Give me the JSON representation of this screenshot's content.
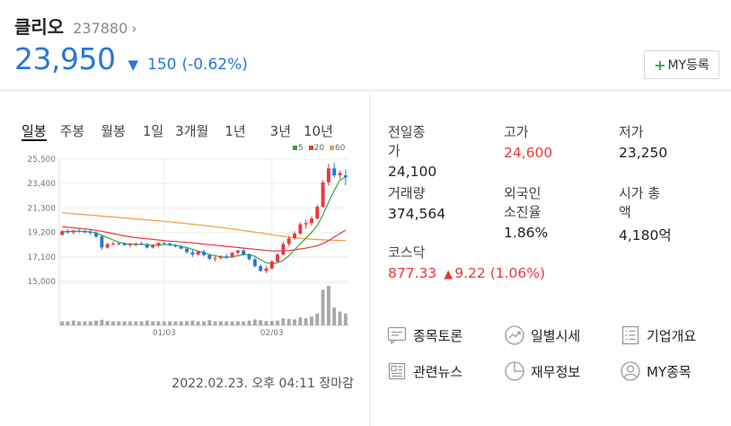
{
  "stock": {
    "name": "클리오",
    "code": "237880",
    "price": "23,950",
    "change": "150",
    "change_pct": "(-0.62%)",
    "direction": "down",
    "my_button": "MY등록"
  },
  "period_tabs": [
    "일봉",
    "주봉",
    "월봉",
    "1일",
    "3개월",
    "1년",
    "3년",
    "10년"
  ],
  "active_tab": "일봉",
  "legend": [
    "5",
    "20",
    "60"
  ],
  "stats": {
    "prev_close_label": "전일종가",
    "prev_close": "24,100",
    "high_label": "고가",
    "high": "24,600",
    "low_label": "저가",
    "low": "23,250",
    "volume_label": "거래량",
    "volume": "374,564",
    "foreign_label": "외국인소진율",
    "foreign": "1.86%",
    "market_cap_label": "시가 총액",
    "market_cap": "4,180억",
    "index_label": "코스닥",
    "index_value": "877.33",
    "index_change": "9.22",
    "index_change_pct": "(1.06%)"
  },
  "links": [
    "종목토론",
    "일별시세",
    "기업개요",
    "관련뉴스",
    "재무정보",
    "MY종목"
  ],
  "timestamp": "2022.02.23. 오후 04:11 장마감",
  "colors": {
    "down": "#2677d9",
    "up": "#e9383f",
    "ma5": "#2fa83a",
    "ma20": "#e9383f",
    "ma60": "#f29a4a"
  },
  "chart_data": {
    "type": "candlestick",
    "y_ticks": [
      "25,500",
      "23,400",
      "21,300",
      "19,200",
      "17,100",
      "15,000"
    ],
    "ylim": [
      15000,
      25500
    ],
    "x_ticks": [
      "01/03",
      "02/03"
    ],
    "x_tick_index": [
      18,
      37
    ],
    "candles": [
      [
        19000,
        19400,
        18900,
        19300
      ],
      [
        19300,
        19500,
        19100,
        19200
      ],
      [
        19200,
        19400,
        19000,
        19350
      ],
      [
        19350,
        19500,
        19150,
        19300
      ],
      [
        19300,
        19450,
        19100,
        19250
      ],
      [
        19250,
        19400,
        19000,
        19150
      ],
      [
        19150,
        19300,
        18700,
        18850
      ],
      [
        18850,
        19000,
        17700,
        17900
      ],
      [
        17900,
        18300,
        17800,
        18200
      ],
      [
        18200,
        18400,
        18050,
        18250
      ],
      [
        18250,
        18400,
        18100,
        18200
      ],
      [
        18200,
        18350,
        18050,
        18100
      ],
      [
        18100,
        18300,
        17900,
        18200
      ],
      [
        18200,
        18350,
        18000,
        18250
      ],
      [
        18250,
        18400,
        18100,
        18150
      ],
      [
        18150,
        18300,
        17800,
        17900
      ],
      [
        17900,
        18200,
        17800,
        18100
      ],
      [
        18100,
        18350,
        17950,
        18300
      ],
      [
        18300,
        18450,
        18200,
        18250
      ],
      [
        18250,
        18350,
        18000,
        18100
      ],
      [
        18100,
        18200,
        17900,
        18000
      ],
      [
        18000,
        18100,
        17750,
        17800
      ],
      [
        17800,
        17950,
        17400,
        17500
      ],
      [
        17500,
        17700,
        17100,
        17300
      ],
      [
        17300,
        17600,
        17200,
        17550
      ],
      [
        17550,
        17700,
        17150,
        17250
      ],
      [
        17250,
        17350,
        16800,
        16950
      ],
      [
        16950,
        17150,
        16700,
        17000
      ],
      [
        17000,
        17250,
        16850,
        17150
      ],
      [
        17150,
        17350,
        16900,
        17050
      ],
      [
        17050,
        17500,
        17000,
        17450
      ],
      [
        17450,
        17700,
        17300,
        17650
      ],
      [
        17650,
        17800,
        17200,
        17300
      ],
      [
        17300,
        17400,
        16800,
        16900
      ],
      [
        16900,
        17050,
        16200,
        16300
      ],
      [
        16300,
        16450,
        15800,
        15900
      ],
      [
        15900,
        16300,
        15700,
        16100
      ],
      [
        16100,
        16800,
        16000,
        16700
      ],
      [
        16700,
        17400,
        16600,
        17300
      ],
      [
        17300,
        18400,
        17200,
        18200
      ],
      [
        18200,
        18900,
        18000,
        18700
      ],
      [
        18700,
        19300,
        18600,
        19100
      ],
      [
        19100,
        20100,
        19000,
        19900
      ],
      [
        19900,
        20300,
        19500,
        20000
      ],
      [
        20000,
        20600,
        19800,
        20400
      ],
      [
        20400,
        21600,
        20300,
        21400
      ],
      [
        21400,
        23700,
        21300,
        23500
      ],
      [
        23500,
        25100,
        23200,
        24700
      ],
      [
        24700,
        25200,
        23900,
        24100
      ],
      [
        24100,
        24500,
        23800,
        24300
      ],
      [
        24100,
        24600,
        23250,
        23950
      ]
    ],
    "ma5": [
      19250,
      19280,
      19300,
      19300,
      19280,
      19250,
      19150,
      18950,
      18750,
      18550,
      18350,
      18250,
      18200,
      18150,
      18200,
      18150,
      18100,
      18100,
      18150,
      18150,
      18100,
      18000,
      17900,
      17750,
      17600,
      17450,
      17300,
      17200,
      17100,
      17050,
      17100,
      17200,
      17300,
      17300,
      17150,
      16850,
      16600,
      16500,
      16600,
      16800,
      17200,
      17700,
      18200,
      18700,
      19200,
      19800,
      20700,
      21800,
      22800,
      23700,
      23950
    ],
    "ma20": [
      19700,
      19650,
      19600,
      19550,
      19500,
      19450,
      19380,
      19300,
      19200,
      19100,
      19000,
      18900,
      18820,
      18750,
      18700,
      18650,
      18600,
      18550,
      18500,
      18450,
      18420,
      18380,
      18340,
      18300,
      18250,
      18200,
      18150,
      18100,
      18050,
      18000,
      17950,
      17900,
      17850,
      17800,
      17750,
      17700,
      17650,
      17600,
      17600,
      17620,
      17650,
      17700,
      17780,
      17850,
      17950,
      18050,
      18250,
      18500,
      18800,
      19100,
      19400
    ],
    "ma60": [
      20900,
      20850,
      20800,
      20760,
      20720,
      20680,
      20640,
      20600,
      20560,
      20520,
      20480,
      20440,
      20400,
      20360,
      20320,
      20280,
      20240,
      20200,
      20150,
      20100,
      20050,
      20000,
      19950,
      19900,
      19850,
      19800,
      19740,
      19680,
      19620,
      19560,
      19500,
      19430,
      19360,
      19290,
      19220,
      19150,
      19080,
      19000,
      18930,
      18870,
      18810,
      18750,
      18700,
      18660,
      18620,
      18590,
      18560,
      18540,
      18520,
      18510,
      18500
    ],
    "volume": [
      10,
      10,
      12,
      10,
      10,
      10,
      12,
      14,
      11,
      10,
      10,
      10,
      10,
      10,
      10,
      12,
      10,
      10,
      10,
      10,
      10,
      10,
      11,
      12,
      10,
      10,
      13,
      10,
      10,
      10,
      10,
      10,
      10,
      12,
      15,
      13,
      11,
      11,
      12,
      18,
      16,
      15,
      20,
      18,
      22,
      30,
      90,
      100,
      45,
      35,
      30
    ]
  }
}
